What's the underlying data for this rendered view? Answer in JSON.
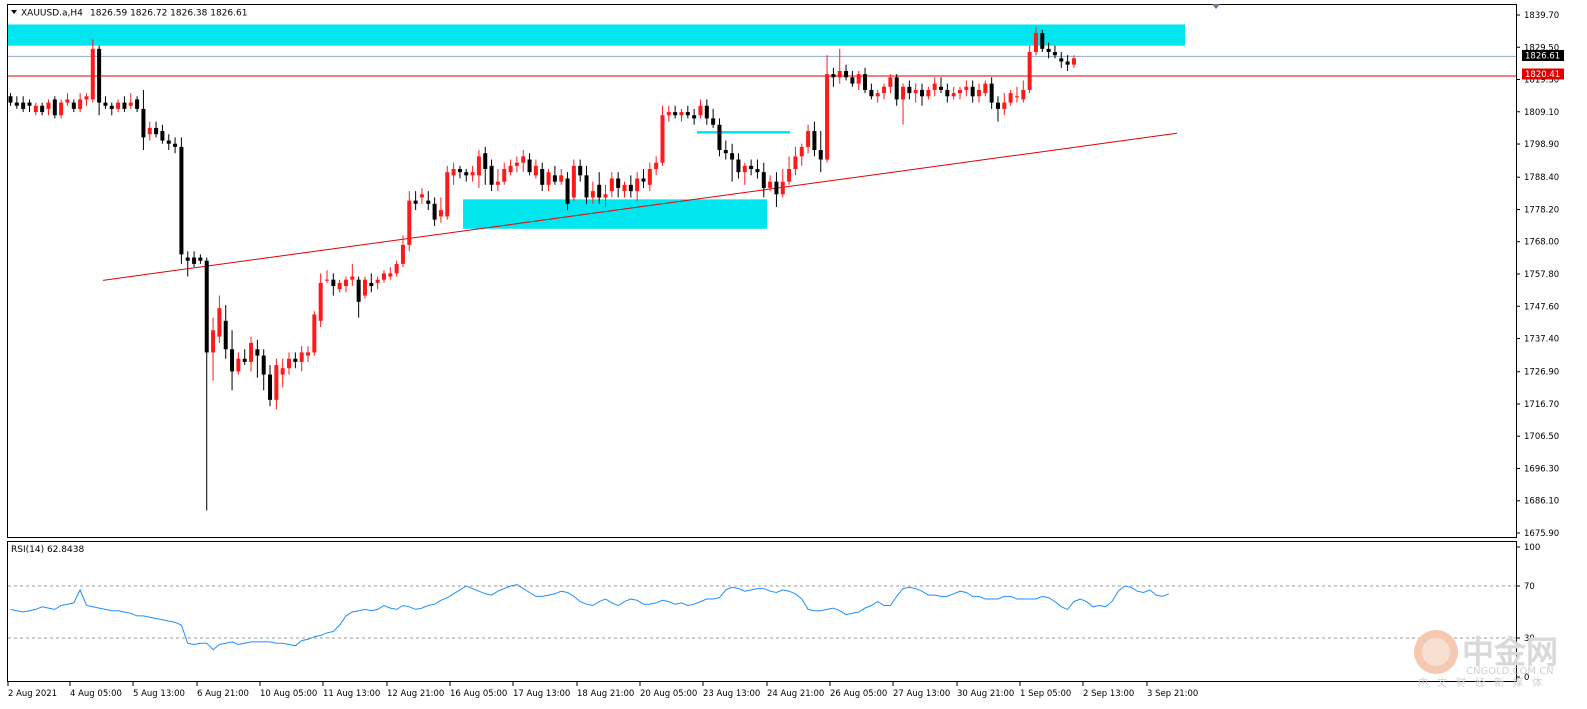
{
  "header": {
    "symbol": "XAUUSD.a,H4",
    "ohlc": "1826.59 1826.72 1826.38 1826.61",
    "rsi_label": "RSI(14) 62.8438"
  },
  "price_axis_labels": [
    "1839.70",
    "1829.50",
    "1819.30",
    "1809.10",
    "1798.90",
    "1788.40",
    "1778.20",
    "1768.00",
    "1757.80",
    "1747.60",
    "1737.40",
    "1726.90",
    "1716.70",
    "1706.50",
    "1696.30",
    "1686.10",
    "1675.90"
  ],
  "rsi_axis_labels": [
    "100",
    "70",
    "30",
    "0"
  ],
  "time_labels": [
    "2 Aug 2021",
    "4 Aug 05:00",
    "5 Aug 13:00",
    "6 Aug 21:00",
    "10 Aug 05:00",
    "11 Aug 13:00",
    "12 Aug 21:00",
    "16 Aug 05:00",
    "17 Aug 13:00",
    "18 Aug 21:00",
    "20 Aug 05:00",
    "23 Aug 13:00",
    "24 Aug 21:00",
    "26 Aug 05:00",
    "27 Aug 13:00",
    "30 Aug 21:00",
    "1 Sep 05:00",
    "2 Sep 13:00",
    "3 Sep 21:00"
  ],
  "current_price_tag": "1826.61",
  "level_tag": "1820.41",
  "watermark": {
    "cn": "中金网",
    "en": "CNGOLD.COM.CN",
    "sub": "中文财经新媒体"
  },
  "colors": {
    "bull": "#ff1a1a",
    "bear": "#000000",
    "zone": "#00e5ee",
    "trendline": "#e00000",
    "rsi_line": "#1e90ff",
    "current_price_line": "#8fa8c8"
  },
  "chart_data": [
    {
      "type": "candlestick",
      "symbol": "XAUUSD.a",
      "timeframe": "H4",
      "ylim": [
        1675.9,
        1839.7
      ],
      "zones": [
        {
          "name": "resistance",
          "from": 1830.0,
          "to": 1836.7
        },
        {
          "name": "support",
          "from": 1772.1,
          "to": 1781.4
        },
        {
          "name": "minor",
          "from": 1802.2,
          "to": 1803.0
        }
      ],
      "levels": [
        {
          "price": 1820.41
        },
        {
          "price": 1826.61
        }
      ],
      "trendlines": [
        {
          "from": [
            0,
            1755.8
          ],
          "to": [
            150,
            1802.3
          ]
        }
      ],
      "x_tick_labels": [
        "2 Aug 2021",
        "4 Aug 05:00",
        "5 Aug 13:00",
        "6 Aug 21:00",
        "10 Aug 05:00",
        "11 Aug 13:00",
        "12 Aug 21:00",
        "16 Aug 05:00",
        "17 Aug 13:00",
        "18 Aug 21:00",
        "20 Aug 05:00",
        "23 Aug 13:00",
        "24 Aug 21:00",
        "26 Aug 05:00",
        "27 Aug 13:00",
        "30 Aug 21:00",
        "1 Sep 05:00",
        "2 Sep 13:00",
        "3 Sep 21:00"
      ],
      "candles": [
        [
          1814,
          1815,
          1811,
          1812
        ],
        [
          1812,
          1814,
          1810,
          1811
        ],
        [
          1812,
          1814,
          1809,
          1810
        ],
        [
          1812,
          1813,
          1809,
          1811
        ],
        [
          1809,
          1812,
          1808,
          1811
        ],
        [
          1811,
          1812,
          1808,
          1809
        ],
        [
          1810,
          1813,
          1808,
          1812
        ],
        [
          1813,
          1814,
          1807,
          1808
        ],
        [
          1808,
          1813,
          1807,
          1812
        ],
        [
          1812,
          1815,
          1811,
          1813
        ],
        [
          1812,
          1813,
          1809,
          1810
        ],
        [
          1810,
          1815,
          1809,
          1813
        ],
        [
          1813,
          1815,
          1811,
          1814
        ],
        [
          1813,
          1832,
          1812,
          1829
        ],
        [
          1829,
          1830,
          1808,
          1812
        ],
        [
          1812,
          1814,
          1810,
          1811
        ],
        [
          1811,
          1812,
          1808,
          1810
        ],
        [
          1810,
          1813,
          1809,
          1812
        ],
        [
          1812,
          1814,
          1809,
          1810
        ],
        [
          1811,
          1815,
          1810,
          1812
        ],
        [
          1813,
          1814,
          1809,
          1810
        ],
        [
          1810,
          1816,
          1797,
          1801
        ],
        [
          1802,
          1806,
          1800,
          1804
        ],
        [
          1804,
          1806,
          1801,
          1802
        ],
        [
          1803,
          1805,
          1799,
          1800
        ],
        [
          1800,
          1802,
          1797,
          1799
        ],
        [
          1799,
          1801,
          1796,
          1798
        ],
        [
          1798,
          1801,
          1761,
          1764
        ],
        [
          1763,
          1765,
          1757,
          1762
        ],
        [
          1763,
          1765,
          1760,
          1761
        ],
        [
          1763,
          1764,
          1761,
          1762
        ],
        [
          1762,
          1763,
          1683,
          1733
        ],
        [
          1733,
          1744,
          1724,
          1740
        ],
        [
          1738,
          1751,
          1736,
          1747
        ],
        [
          1743,
          1748,
          1731,
          1734
        ],
        [
          1734,
          1740,
          1721,
          1727
        ],
        [
          1727,
          1733,
          1726,
          1731
        ],
        [
          1731,
          1734,
          1729,
          1730
        ],
        [
          1730,
          1738,
          1727,
          1736
        ],
        [
          1734,
          1737,
          1725,
          1732
        ],
        [
          1732,
          1734,
          1721,
          1726
        ],
        [
          1726,
          1729,
          1716,
          1718
        ],
        [
          1718,
          1731,
          1715,
          1729
        ],
        [
          1726,
          1731,
          1722,
          1728
        ],
        [
          1728,
          1733,
          1726,
          1731
        ],
        [
          1731,
          1733,
          1728,
          1730
        ],
        [
          1730,
          1735,
          1727,
          1733
        ],
        [
          1732,
          1735,
          1730,
          1733
        ],
        [
          1733,
          1746,
          1732,
          1745
        ],
        [
          1743,
          1758,
          1741,
          1755
        ],
        [
          1756,
          1759,
          1755,
          1756
        ],
        [
          1756,
          1758,
          1751,
          1754
        ],
        [
          1753,
          1756,
          1752,
          1755
        ],
        [
          1754,
          1757,
          1752,
          1756
        ],
        [
          1756,
          1761,
          1754,
          1757
        ],
        [
          1756,
          1757,
          1744,
          1749
        ],
        [
          1751,
          1757,
          1750,
          1756
        ],
        [
          1755,
          1758,
          1752,
          1754
        ],
        [
          1755,
          1757,
          1753,
          1756
        ],
        [
          1756,
          1759,
          1755,
          1758
        ],
        [
          1757,
          1760,
          1756,
          1758
        ],
        [
          1758,
          1762,
          1757,
          1761
        ],
        [
          1761,
          1770,
          1760,
          1767
        ],
        [
          1767,
          1784,
          1765,
          1781
        ],
        [
          1781,
          1784,
          1778,
          1780
        ],
        [
          1782,
          1785,
          1780,
          1783
        ],
        [
          1781,
          1784,
          1778,
          1780
        ],
        [
          1780,
          1782,
          1773,
          1775
        ],
        [
          1776,
          1782,
          1774,
          1778
        ],
        [
          1776,
          1792,
          1775,
          1790
        ],
        [
          1789,
          1793,
          1786,
          1791
        ],
        [
          1791,
          1792,
          1788,
          1790
        ],
        [
          1790,
          1791,
          1787,
          1789
        ],
        [
          1789,
          1792,
          1787,
          1790
        ],
        [
          1789,
          1797,
          1785,
          1795
        ],
        [
          1796,
          1798,
          1786,
          1791
        ],
        [
          1792,
          1794,
          1784,
          1786
        ],
        [
          1786,
          1791,
          1784,
          1787
        ],
        [
          1787,
          1793,
          1786,
          1791
        ],
        [
          1790,
          1794,
          1789,
          1792
        ],
        [
          1792,
          1795,
          1790,
          1793
        ],
        [
          1793,
          1797,
          1790,
          1795
        ],
        [
          1794,
          1796,
          1789,
          1790
        ],
        [
          1789,
          1794,
          1788,
          1792
        ],
        [
          1791,
          1793,
          1784,
          1786
        ],
        [
          1786,
          1791,
          1784,
          1790
        ],
        [
          1789,
          1792,
          1786,
          1787
        ],
        [
          1787,
          1791,
          1786,
          1789
        ],
        [
          1788,
          1790,
          1778,
          1780
        ],
        [
          1782,
          1794,
          1781,
          1792
        ],
        [
          1792,
          1794,
          1787,
          1789
        ],
        [
          1789,
          1792,
          1780,
          1782
        ],
        [
          1782,
          1787,
          1780,
          1784
        ],
        [
          1786,
          1790,
          1780,
          1782
        ],
        [
          1782,
          1786,
          1779,
          1783
        ],
        [
          1784,
          1790,
          1782,
          1788
        ],
        [
          1788,
          1790,
          1782,
          1785
        ],
        [
          1784,
          1787,
          1782,
          1786
        ],
        [
          1786,
          1789,
          1782,
          1784
        ],
        [
          1784,
          1790,
          1781,
          1788
        ],
        [
          1788,
          1791,
          1785,
          1787
        ],
        [
          1786,
          1793,
          1784,
          1791
        ],
        [
          1791,
          1795,
          1789,
          1793
        ],
        [
          1793,
          1811,
          1792,
          1808
        ],
        [
          1808,
          1811,
          1806,
          1809
        ],
        [
          1809,
          1811,
          1807,
          1808
        ],
        [
          1808,
          1810,
          1806,
          1809
        ],
        [
          1809,
          1811,
          1807,
          1808
        ],
        [
          1808,
          1810,
          1805,
          1807
        ],
        [
          1808,
          1813,
          1807,
          1811
        ],
        [
          1811,
          1813,
          1805,
          1807
        ],
        [
          1807,
          1810,
          1804,
          1805
        ],
        [
          1805,
          1807,
          1795,
          1797
        ],
        [
          1797,
          1800,
          1794,
          1796
        ],
        [
          1796,
          1799,
          1787,
          1794
        ],
        [
          1794,
          1796,
          1788,
          1790
        ],
        [
          1790,
          1793,
          1786,
          1792
        ],
        [
          1792,
          1794,
          1789,
          1791
        ],
        [
          1791,
          1794,
          1788,
          1790
        ],
        [
          1790,
          1793,
          1782,
          1785
        ],
        [
          1785,
          1789,
          1784,
          1787
        ],
        [
          1787,
          1790,
          1779,
          1783
        ],
        [
          1783,
          1791,
          1782,
          1787
        ],
        [
          1787,
          1795,
          1786,
          1791
        ],
        [
          1791,
          1798,
          1789,
          1795
        ],
        [
          1795,
          1799,
          1792,
          1798
        ],
        [
          1798,
          1805,
          1796,
          1803
        ],
        [
          1803,
          1806,
          1795,
          1797
        ],
        [
          1797,
          1803,
          1790,
          1794
        ],
        [
          1794,
          1827,
          1793,
          1821
        ],
        [
          1821,
          1823,
          1817,
          1820
        ],
        [
          1820,
          1829,
          1818,
          1822
        ],
        [
          1822,
          1824,
          1819,
          1820
        ],
        [
          1820,
          1822,
          1817,
          1818
        ],
        [
          1818,
          1822,
          1816,
          1821
        ],
        [
          1821,
          1823,
          1815,
          1816
        ],
        [
          1816,
          1818,
          1813,
          1814
        ],
        [
          1814,
          1816,
          1812,
          1815
        ],
        [
          1815,
          1818,
          1813,
          1817
        ],
        [
          1817,
          1821,
          1815,
          1820
        ],
        [
          1820,
          1821,
          1811,
          1813
        ],
        [
          1813,
          1818,
          1805,
          1817
        ],
        [
          1817,
          1819,
          1813,
          1815
        ],
        [
          1815,
          1818,
          1812,
          1816
        ],
        [
          1816,
          1818,
          1811,
          1814
        ],
        [
          1814,
          1817,
          1813,
          1816
        ],
        [
          1816,
          1820,
          1814,
          1818
        ],
        [
          1817,
          1820,
          1815,
          1816
        ],
        [
          1816,
          1818,
          1812,
          1814
        ],
        [
          1814,
          1817,
          1813,
          1815
        ],
        [
          1815,
          1817,
          1813,
          1816
        ],
        [
          1816,
          1819,
          1814,
          1817
        ],
        [
          1817,
          1819,
          1812,
          1814
        ],
        [
          1814,
          1818,
          1812,
          1816
        ],
        [
          1815,
          1819,
          1814,
          1818
        ],
        [
          1818,
          1820,
          1810,
          1812
        ],
        [
          1812,
          1814,
          1806,
          1810
        ],
        [
          1810,
          1815,
          1808,
          1812
        ],
        [
          1812,
          1816,
          1811,
          1815
        ],
        [
          1814,
          1817,
          1812,
          1814
        ],
        [
          1813,
          1819,
          1812,
          1816
        ],
        [
          1816,
          1830,
          1815,
          1828
        ],
        [
          1828,
          1836,
          1827,
          1834
        ],
        [
          1834,
          1835,
          1828,
          1829
        ],
        [
          1829,
          1831,
          1826,
          1828
        ],
        [
          1828,
          1830,
          1826,
          1827
        ],
        [
          1826,
          1828,
          1823,
          1825
        ],
        [
          1825,
          1827,
          1822,
          1824
        ],
        [
          1824,
          1827,
          1823,
          1826
        ]
      ]
    },
    {
      "type": "line",
      "title": "RSI(14) 62.8438",
      "ylim": [
        0,
        100
      ],
      "levels": [
        30,
        70
      ],
      "series": [
        {
          "values": [
            52,
            51,
            50,
            51,
            52,
            54,
            53,
            52,
            55,
            56,
            57,
            67,
            55,
            54,
            53,
            52,
            51,
            51,
            50,
            49,
            47,
            47,
            46,
            45,
            44,
            43,
            42,
            40,
            26,
            25,
            26,
            26,
            21,
            25,
            26,
            27,
            25,
            26,
            27,
            27,
            27,
            27,
            26,
            26,
            25,
            24,
            28,
            29,
            31,
            32,
            34,
            35,
            40,
            47,
            50,
            51,
            52,
            51,
            52,
            55,
            53,
            52,
            55,
            54,
            52,
            53,
            55,
            56,
            59,
            61,
            64,
            67,
            70,
            68,
            66,
            64,
            63,
            66,
            68,
            70,
            71,
            68,
            65,
            62,
            62,
            63,
            64,
            66,
            65,
            62,
            58,
            56,
            55,
            58,
            60,
            57,
            55,
            58,
            60,
            59,
            56,
            56,
            57,
            59,
            58,
            56,
            57,
            55,
            56,
            58,
            60,
            60,
            61,
            67,
            69,
            68,
            66,
            67,
            68,
            68,
            66,
            65,
            67,
            66,
            64,
            60,
            52,
            51,
            51,
            52,
            53,
            51,
            48,
            49,
            50,
            53,
            55,
            58,
            55,
            55,
            62,
            68,
            69,
            68,
            66,
            63,
            63,
            62,
            62,
            64,
            66,
            65,
            62,
            62,
            60,
            60,
            60,
            62,
            62,
            60,
            60,
            60,
            60,
            62,
            61,
            58,
            54,
            52,
            58,
            60,
            58,
            54,
            55,
            54,
            58,
            66,
            70,
            69,
            66,
            65,
            67,
            63,
            62,
            64
          ]
        }
      ]
    }
  ]
}
